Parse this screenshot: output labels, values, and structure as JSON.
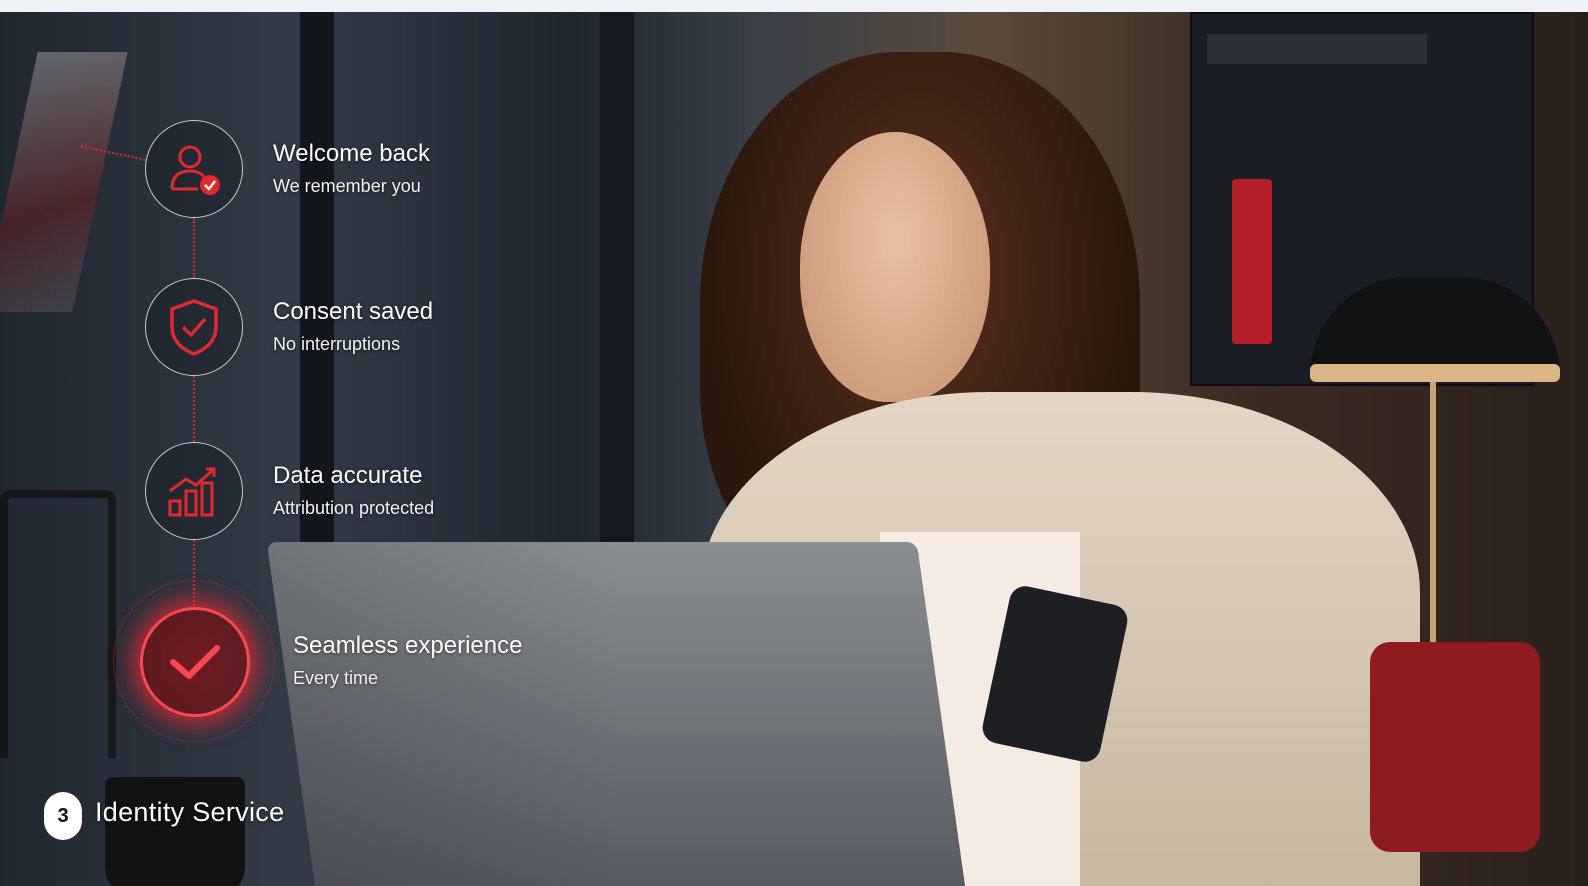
{
  "steps": [
    {
      "title": "Welcome back",
      "subtitle": "We remember you",
      "icon": "user-check-icon"
    },
    {
      "title": "Consent saved",
      "subtitle": "No interruptions",
      "icon": "shield-check-icon"
    },
    {
      "title": "Data accurate",
      "subtitle": "Attribution protected",
      "icon": "bar-chart-growth-icon"
    },
    {
      "title": "Seamless experience",
      "subtitle": "Every time",
      "icon": "check-icon"
    }
  ],
  "footer": {
    "step_number": "3",
    "service_name": "Identity Service"
  },
  "colors": {
    "accent": "#e0282f",
    "text": "#ffffff",
    "badge_bg": "#ffffff"
  }
}
